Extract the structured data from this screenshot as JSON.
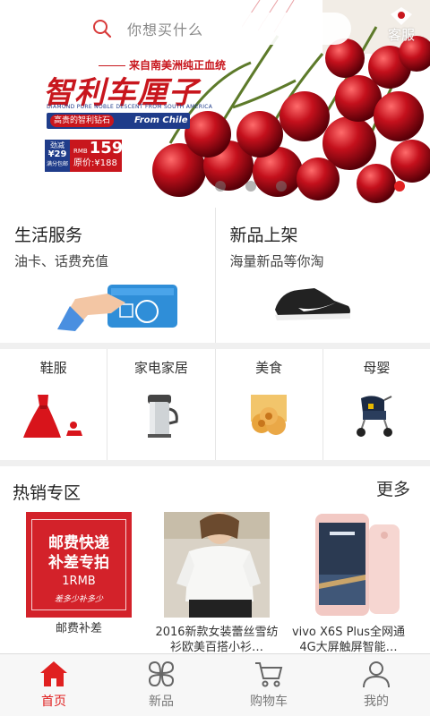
{
  "search": {
    "placeholder": "你想买什么",
    "icon": "search-icon"
  },
  "customer_service": {
    "label": "客服",
    "icon": "chat-bubble-icon"
  },
  "banner": {
    "origin_text": "来自南美洲纯正血统",
    "title": "智利车厘子",
    "subtitle_en": "DIAMOND PURE NOBLE DESCENT FROM SOUTH AMERICA",
    "tag_text": "高贵的智利钻石",
    "tag_from": "From Chile",
    "price_badge_line1": "劲减",
    "price_badge_line2": "¥29",
    "price_badge_line3": "满分包邮",
    "price_currency": "RMB",
    "price": "159",
    "original_price": "原价:¥188",
    "accent_color": "#c8161d",
    "navy_color": "#1f3c8a"
  },
  "services": [
    {
      "title": "生活服务",
      "subtitle": "油卡、话费充值",
      "image": "card-payment-illustration"
    },
    {
      "title": "新品上架",
      "subtitle": "海量新品等你淘",
      "image": "sneaker-image"
    }
  ],
  "categories": [
    {
      "label": "鞋服",
      "image": "red-dress-image"
    },
    {
      "label": "家电家居",
      "image": "soymilk-maker-image"
    },
    {
      "label": "美食",
      "image": "pastry-image"
    },
    {
      "label": "母婴",
      "image": "baby-stroller-image"
    }
  ],
  "hot_zone": {
    "title": "热销专区",
    "more": "更多",
    "items": [
      {
        "name": "邮费补差",
        "pic_line1": "邮费快递",
        "pic_line2": "补差专拍",
        "pic_line3": "1RMB",
        "pic_line4": "差多少补多少"
      },
      {
        "name": "2016新款女装蕾丝雪纺衫欧美百搭小衫…",
        "image": "lace-blouse-image"
      },
      {
        "name": "vivo X6S Plus全网通4G大屏触屏智能…",
        "image": "pink-smartphone-image"
      }
    ]
  },
  "bottom_nav": [
    {
      "label": "首页",
      "icon": "home-icon",
      "active": true
    },
    {
      "label": "新品",
      "icon": "clover-icon",
      "active": false
    },
    {
      "label": "购物车",
      "icon": "cart-icon",
      "active": false
    },
    {
      "label": "我的",
      "icon": "user-icon",
      "active": false
    }
  ],
  "colors": {
    "active": "#e02020",
    "inactive": "#777777"
  }
}
